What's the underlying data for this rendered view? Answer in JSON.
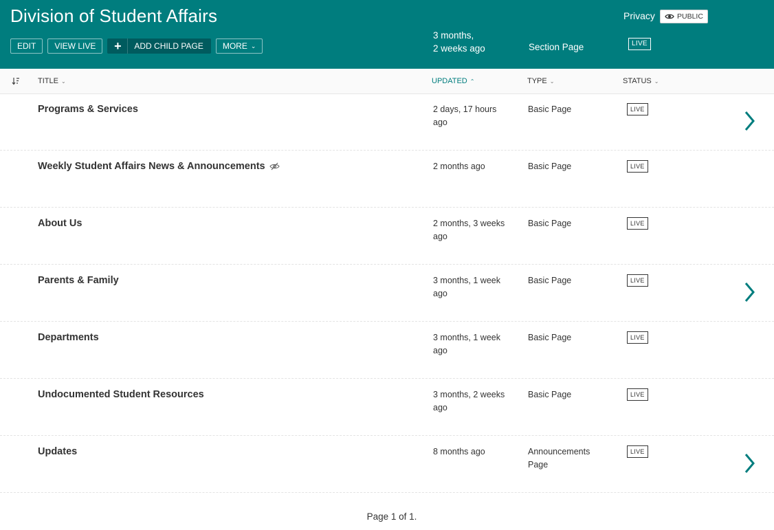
{
  "header": {
    "title": "Division of Student Affairs",
    "actions": {
      "edit": "EDIT",
      "view_live": "VIEW LIVE",
      "add_child": "ADD CHILD PAGE",
      "more": "MORE"
    },
    "updated_line1": "3 months,",
    "updated_line2": "2 weeks ago",
    "type": "Section Page",
    "status": "LIVE",
    "privacy_label": "Privacy",
    "privacy_value": "PUBLIC"
  },
  "columns": {
    "title": "TITLE",
    "updated": "UPDATED",
    "type": "TYPE",
    "status": "STATUS"
  },
  "rows": [
    {
      "title": "Programs & Services",
      "updated": "2 days, 17 hours ago",
      "type": "Basic Page",
      "status": "LIVE",
      "has_children": true,
      "private": false
    },
    {
      "title": "Weekly Student Affairs News & Announcements",
      "updated": "2 months ago",
      "type": "Basic Page",
      "status": "LIVE",
      "has_children": false,
      "private": true
    },
    {
      "title": "About Us",
      "updated": "2 months, 3 weeks ago",
      "type": "Basic Page",
      "status": "LIVE",
      "has_children": false,
      "private": false
    },
    {
      "title": "Parents & Family",
      "updated": "3 months, 1 week ago",
      "type": "Basic Page",
      "status": "LIVE",
      "has_children": true,
      "private": false
    },
    {
      "title": "Departments",
      "updated": "3 months, 1 week ago",
      "type": "Basic Page",
      "status": "LIVE",
      "has_children": false,
      "private": false
    },
    {
      "title": "Undocumented Student Resources",
      "updated": "3 months, 2 weeks ago",
      "type": "Basic Page",
      "status": "LIVE",
      "has_children": false,
      "private": false
    },
    {
      "title": "Updates",
      "updated": "8 months ago",
      "type": "Announcements Page",
      "status": "LIVE",
      "has_children": true,
      "private": false
    }
  ],
  "pagination": "Page 1 of 1.",
  "colors": {
    "accent": "#007d7e",
    "accent_dark": "#005b5e"
  }
}
